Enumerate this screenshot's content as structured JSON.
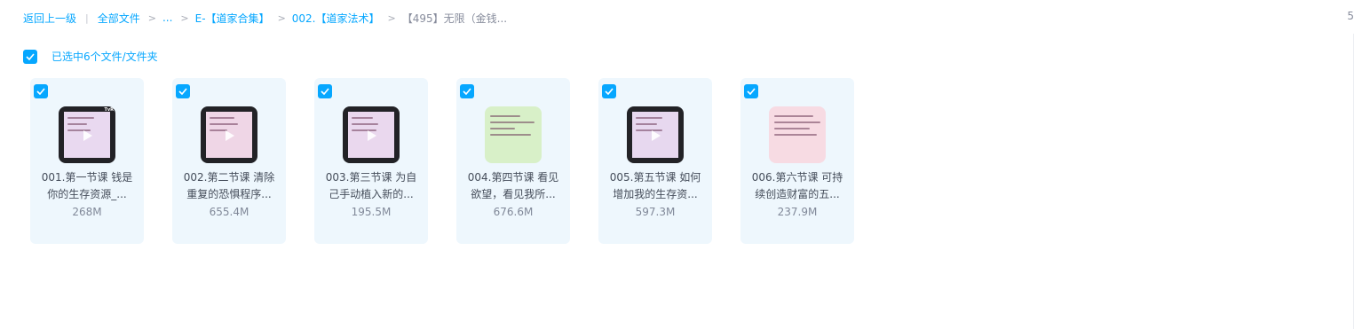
{
  "breadcrumb": {
    "back": "返回上一级",
    "all_files": "全部文件",
    "ellipsis": "...",
    "folder1": "E-【道家合集】",
    "folder2": "002.【道家法术】",
    "current": "【495】无限（金钱..."
  },
  "corner_mark": "5",
  "selection": {
    "label": "已选中6个文件/文件夹",
    "checked": true
  },
  "files": [
    {
      "name_line1": "001.第一节课 钱是",
      "name_line2": "你的生存资源_...",
      "size": "268M",
      "thumb": "video",
      "thumb_color": "#e9d9f0"
    },
    {
      "name_line1": "002.第二节课 清除",
      "name_line2": "重复的恐惧程序...",
      "size": "655.4M",
      "thumb": "video",
      "thumb_color": "#efd6e6"
    },
    {
      "name_line1": "003.第三节课 为自",
      "name_line2": "己手动植入新的...",
      "size": "195.5M",
      "thumb": "video",
      "thumb_color": "#ead8ee"
    },
    {
      "name_line1": "004.第四节课 看见",
      "name_line2": "欲望，看见我所...",
      "size": "676.6M",
      "thumb": "image",
      "thumb_color": "#d8f0c8"
    },
    {
      "name_line1": "005.第五节课 如何",
      "name_line2": "增加我的生存资...",
      "size": "597.3M",
      "thumb": "video",
      "thumb_color": "#e7d8ef"
    },
    {
      "name_line1": "006.第六节课 可持",
      "name_line2": "续创造财富的五...",
      "size": "237.9M",
      "thumb": "image",
      "thumb_color": "#f7dbe3"
    }
  ],
  "colors": {
    "accent": "#06a7ff",
    "card_bg": "#eef7fd",
    "text": "#454d5a",
    "muted": "#818999"
  }
}
